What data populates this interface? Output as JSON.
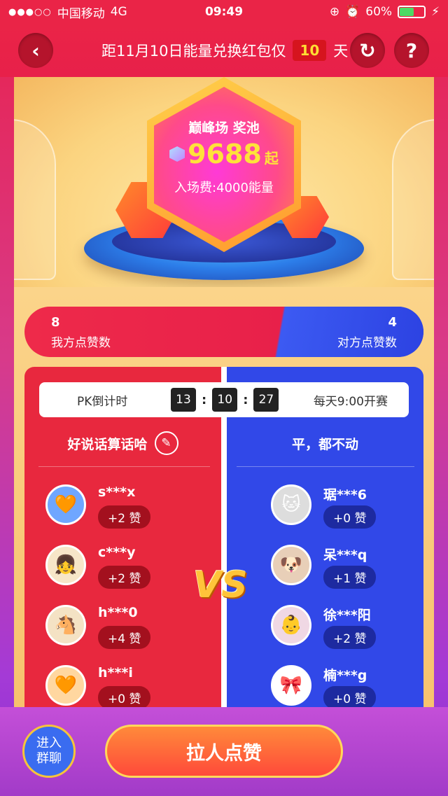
{
  "status_bar": {
    "signal": "●●●○○",
    "carrier": "中国移动",
    "network": "4G",
    "time": "09:49",
    "battery_percent": "60%",
    "battery_level": 0.6
  },
  "header": {
    "title": "距11月10日能量兑换红包仅",
    "days": "10",
    "days_suffix": "天",
    "back_icon": "‹",
    "refresh_icon": "↻",
    "help_icon": "?"
  },
  "prize": {
    "title": "巅峰场 奖池",
    "amount": "9688",
    "amount_suffix": "起",
    "entry_fee": "入场费:4000能量"
  },
  "likes": {
    "ours_count": "8",
    "ours_label": "我方点赞数",
    "theirs_count": "4",
    "theirs_label": "对方点赞数"
  },
  "countdown": {
    "label": "PK倒计时",
    "hours": "13",
    "minutes": "10",
    "seconds": "27",
    "schedule": "每天9:00开赛"
  },
  "teams": {
    "left_name": "好说话算话哈",
    "right_name": "平，都不动",
    "vs": "VS",
    "left_members": [
      {
        "name": "s***x",
        "likes": "+2 赞"
      },
      {
        "name": "c***y",
        "likes": "+2 赞"
      },
      {
        "name": "h***0",
        "likes": "+4 赞"
      },
      {
        "name": "h***i",
        "likes": "+0 赞"
      }
    ],
    "right_members": [
      {
        "name": "琚***6",
        "likes": "+0 赞"
      },
      {
        "name": "呆***q",
        "likes": "+1 赞"
      },
      {
        "name": "徐***阳",
        "likes": "+2 赞"
      },
      {
        "name": "楠***g",
        "likes": "+0 赞"
      }
    ]
  },
  "bottom": {
    "group_chat_label": "进入群聊",
    "invite_label": "拉人点赞"
  },
  "colors": {
    "left_team": "#e8283e",
    "right_team": "#3148e8",
    "accent_gold": "#ffe23a"
  }
}
